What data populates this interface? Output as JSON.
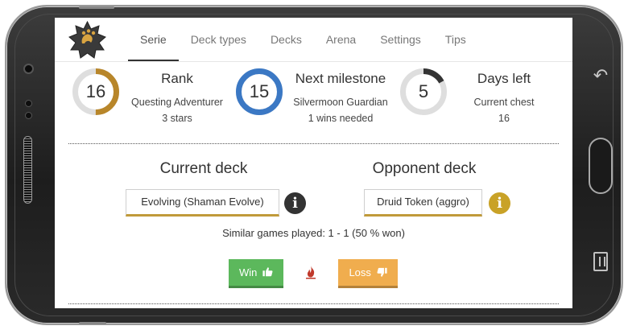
{
  "nav": {
    "tabs": [
      {
        "label": "Serie",
        "active": true
      },
      {
        "label": "Deck types",
        "active": false
      },
      {
        "label": "Decks",
        "active": false
      },
      {
        "label": "Arena",
        "active": false
      },
      {
        "label": "Settings",
        "active": false
      },
      {
        "label": "Tips",
        "active": false
      }
    ]
  },
  "stats": {
    "rank": {
      "value": "16",
      "title": "Rank",
      "line1": "Questing Adventurer",
      "line2": "3 stars",
      "progress": 0.5,
      "color": "#b8862a"
    },
    "milestone": {
      "value": "15",
      "title": "Next milestone",
      "line1": "Silvermoon Guardian",
      "line2": "1 wins needed",
      "progress": 1.0,
      "color": "#3b78c4"
    },
    "days": {
      "value": "5",
      "title": "Days left",
      "line1": "Current chest",
      "line2": "16",
      "progress": 0.17,
      "color": "#333333"
    }
  },
  "decks": {
    "current_heading": "Current deck",
    "current_name": "Evolving (Shaman Evolve)",
    "opponent_heading": "Opponent deck",
    "opponent_name": "Druid Token (aggro)",
    "info_icon": "info-circle",
    "current_info_color": "#333333",
    "opponent_info_color": "#c9a227"
  },
  "similar_games": "Similar games played: 1 - 1 (50 % won)",
  "actions": {
    "win_label": "Win",
    "loss_label": "Loss",
    "win_icon": "thumbs-up",
    "loss_icon": "thumbs-down",
    "streak_icon": "flame",
    "win_color": "#5cb85c",
    "loss_color": "#f0ad4e"
  }
}
